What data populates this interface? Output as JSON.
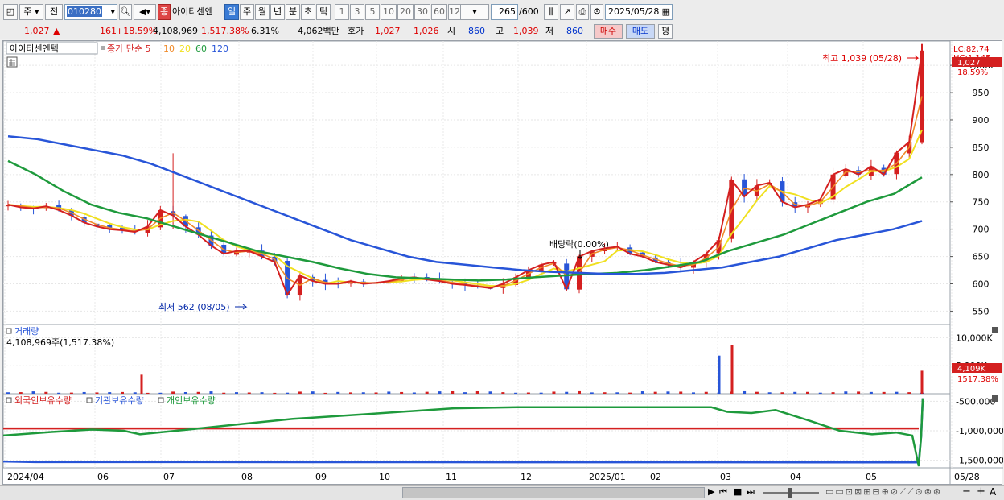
{
  "toolbar": {
    "period_label": "주",
    "prev_label": "전",
    "stock_code": "010280",
    "stock_badge": "종",
    "stock_name": "아이티센엔",
    "period_tabs": [
      "일",
      "주",
      "월",
      "년",
      "분",
      "초",
      "틱"
    ],
    "active_period": "일",
    "interval_tabs": [
      "1",
      "3",
      "5",
      "10",
      "20",
      "30",
      "60",
      "120"
    ],
    "count_value": "265",
    "count_total": "/600",
    "date_value": "2025/05/28"
  },
  "quote": {
    "price": "1,027",
    "change": "161",
    "change_pct": "+18.59%",
    "volume": "4,108,969",
    "volume_pct": "1,517.38%",
    "turnover": "6.31%",
    "amount": "4,062백만",
    "bid_label": "호가",
    "ask_price": "1,027",
    "bid_price": "1,026",
    "open_label": "시",
    "open_value": "860",
    "high_label": "고",
    "high_value": "1,039",
    "low_label": "저",
    "low_value": "860",
    "buy_label": "매수",
    "sell_label": "매도",
    "eval_label": "평"
  },
  "price_panel": {
    "name_tag": "아이티센엔텍",
    "ma_legend": [
      {
        "label": "종가 단순 5",
        "color": "#d42020"
      },
      {
        "label": "10",
        "color": "#f08a28"
      },
      {
        "label": "20",
        "color": "#f0e020"
      },
      {
        "label": "60",
        "color": "#1e9a3c"
      },
      {
        "label": "120",
        "color": "#2855d8"
      }
    ],
    "lc_label": "LC:82,74",
    "hc_label": "HC:1,145",
    "last_price_tag": "1,027",
    "last_pct_tag": "18.59%",
    "y_ticks": [
      "1,000",
      "950",
      "900",
      "850",
      "800",
      "750",
      "700",
      "650",
      "600",
      "550"
    ],
    "high_annotation": "최고 1,039 (05/28)",
    "low_annotation": "최저 562 (08/05)",
    "dividend_annotation": "배당락(0.00%)"
  },
  "volume_panel": {
    "title": "거래량",
    "value": "4,108,969주(1,517.38%)",
    "y_ticks": [
      "10,000K",
      "5,000K"
    ],
    "last_tag": "4,109K",
    "last_pct": "1517.38%"
  },
  "holdings_panel": {
    "legend": [
      "외국인보유수량",
      "기관보유수량",
      "개인보유수량"
    ],
    "legend_colors": [
      "#d42020",
      "#2855d8",
      "#1e9a3c"
    ],
    "y_ticks": [
      "-500,000",
      "-1,000,000",
      "-1,500,000"
    ]
  },
  "x_axis": [
    "2024/04",
    "06",
    "07",
    "08",
    "09",
    "10",
    "11",
    "12",
    "2025/01",
    "02",
    "03",
    "04",
    "05",
    "05/28"
  ],
  "chart_data": {
    "type": "candlestick",
    "symbol": "010280",
    "period": "daily",
    "date_range": [
      "2024/04",
      "2025/05/28"
    ],
    "price_ylim": [
      530,
      1040
    ],
    "price": {
      "last": 1027,
      "open": 860,
      "high": 1039,
      "low": 860,
      "change": 161,
      "change_pct": 18.59,
      "period_high": 1039,
      "period_high_date": "05/28",
      "period_low": 562,
      "period_low_date": "08/05"
    },
    "close_approx": [
      745,
      740,
      738,
      742,
      735,
      725,
      712,
      705,
      700,
      698,
      695,
      705,
      735,
      725,
      705,
      690,
      670,
      655,
      660,
      660,
      650,
      640,
      580,
      615,
      605,
      600,
      600,
      605,
      600,
      602,
      605,
      610,
      612,
      608,
      605,
      600,
      598,
      595,
      592,
      600,
      612,
      625,
      635,
      640,
      590,
      650,
      660,
      665,
      668,
      655,
      650,
      640,
      635,
      630,
      640,
      655,
      680,
      790,
      760,
      780,
      785,
      750,
      740,
      745,
      755,
      800,
      810,
      800,
      815,
      800,
      840,
      860,
      1027
    ],
    "ma120_approx": [
      870,
      865,
      855,
      845,
      835,
      820,
      800,
      780,
      760,
      740,
      720,
      700,
      680,
      665,
      650,
      640,
      635,
      630,
      625,
      622,
      620,
      618,
      618,
      620,
      625,
      630,
      640,
      650,
      665,
      680,
      690,
      700,
      715
    ],
    "ma60_approx": [
      825,
      800,
      770,
      745,
      730,
      720,
      705,
      690,
      675,
      660,
      650,
      640,
      628,
      618,
      612,
      610,
      608,
      606,
      608,
      612,
      615,
      618,
      620,
      625,
      632,
      640,
      660,
      675,
      690,
      710,
      730,
      750,
      765,
      795
    ],
    "volume_unit": "K shares",
    "volume_last": 4109,
    "volume_ticks": [
      5000,
      10000
    ],
    "volume_spikes": [
      {
        "date": "2024/06 late",
        "value": 3400
      },
      {
        "date": "2025/03 early",
        "value": 6800
      },
      {
        "date": "2025/03 early",
        "value": 8700
      },
      {
        "date": "2025/05/28",
        "value": 4109
      }
    ],
    "holdings": {
      "series": [
        "외국인보유수량",
        "기관보유수량",
        "개인보유수량"
      ],
      "ylim": [
        -1600000,
        -400000
      ]
    }
  }
}
